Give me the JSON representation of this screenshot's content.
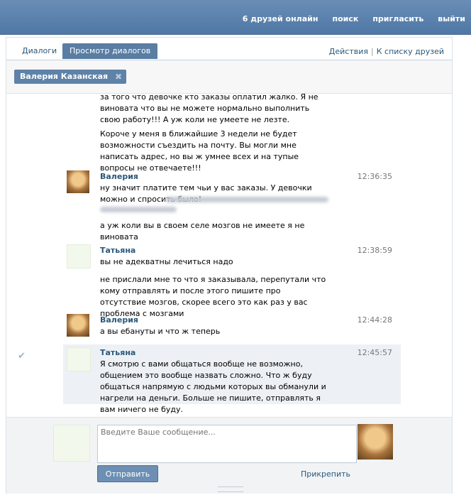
{
  "topnav": [
    "6 друзей онлайн",
    "поиск",
    "пригласить",
    "выйти"
  ],
  "tabs": {
    "dialogs": "Диалоги",
    "view": "Просмотр диалогов"
  },
  "links": {
    "actions": "Действия",
    "sep": "|",
    "friends": "К списку друзей"
  },
  "chip": {
    "name": "Валерия Казанская",
    "close": "✖"
  },
  "messages": [
    {
      "paragraphs": [
        "за того что девочке кто заказы оплатил жалко. Я не виновата что вы не можете нормально выполнить свою работу!!! А уж коли не умеете не лезте.",
        "Короче у меня в ближайшие 3 недели не будет возможности съездить на почту. Вы могли мне написать адрес, но вы ж умнее всех и на тупые вопросы не отвечаете!!!"
      ]
    },
    {
      "name": "Валерия",
      "time": "12:36:35",
      "paragraphs": [
        "ну значит платите тем чьи у вас заказы. У девочки можно и спросить было!",
        "а уж коли вы в своем селе мозгов не имеете я не виновата"
      ]
    },
    {
      "name": "Татьяна",
      "time": "12:38:59",
      "paragraphs": [
        "вы не адекватны лечиться надо",
        "не прислали мне то что я заказывала, перепутали что кому отправлять и после этого пишите про отсутствие мозгов, скорее всего это как раз у вас проблема с мозгами"
      ]
    },
    {
      "name": "Валерия",
      "time": "12:44:28",
      "paragraphs": [
        "а вы ебануты и что ж теперь"
      ]
    },
    {
      "name": "Татьяна",
      "time": "12:45:57",
      "paragraphs": [
        "Я смотрю с вами общаться вообще не возможно, общением это вообще назвать сложно. Что ж буду общаться напрямую с людьми которых вы обманули и нагрели на деньги. Больше не пишите, отправлять я вам ничего не буду."
      ]
    }
  ],
  "check_icon": "✔",
  "composer": {
    "placeholder": "Введите Ваше сообщение...",
    "send": "Отправить",
    "attach": "Прикрепить"
  }
}
